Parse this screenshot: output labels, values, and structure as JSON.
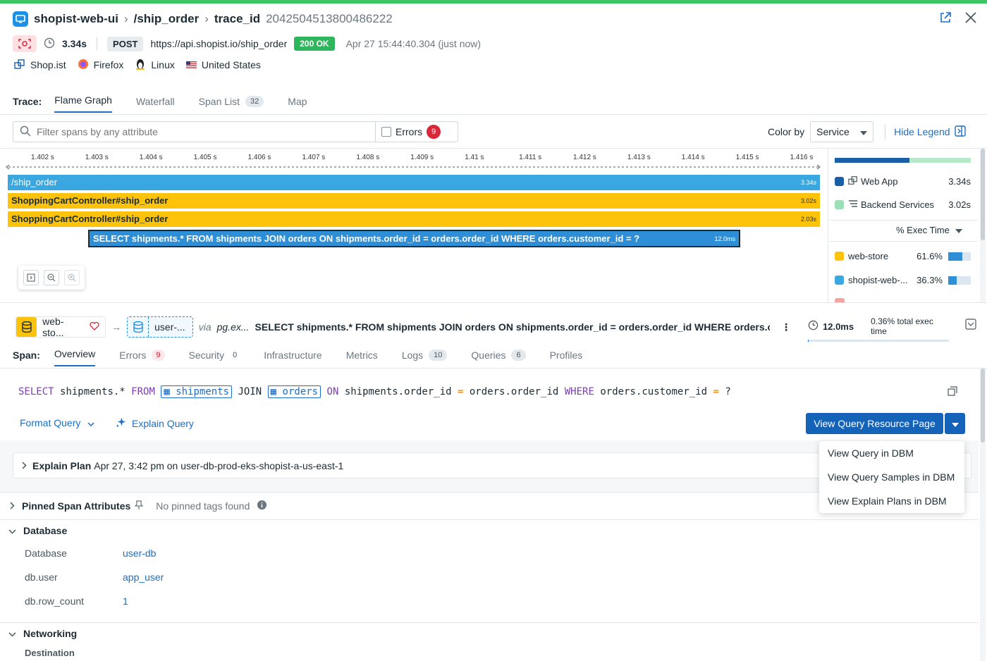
{
  "header": {
    "service": "shopist-web-ui",
    "resource": "/ship_order",
    "trace_label": "trace_id",
    "trace_id": "2042504513800486222"
  },
  "request": {
    "duration": "3.34s",
    "method": "POST",
    "url": "https://api.shopist.io/ship_order",
    "status": "200 OK",
    "timestamp": "Apr 27 15:44:40.304 (just now)"
  },
  "tags": {
    "app": "Shop.ist",
    "browser": "Firefox",
    "os": "Linux",
    "country": "United States"
  },
  "trace_tabs": {
    "label": "Trace:",
    "items": [
      {
        "label": "Flame Graph",
        "badge": ""
      },
      {
        "label": "Waterfall",
        "badge": ""
      },
      {
        "label": "Span List",
        "badge": "32"
      },
      {
        "label": "Map",
        "badge": ""
      }
    ]
  },
  "filter": {
    "placeholder": "Filter spans by any attribute",
    "errors_label": "Errors",
    "errors_count": "9",
    "color_by_label": "Color by",
    "color_by_value": "Service",
    "hide_legend": "Hide Legend"
  },
  "timeline": {
    "ticks": [
      "1.402 s",
      "1.403 s",
      "1.404 s",
      "1.405 s",
      "1.406 s",
      "1.407 s",
      "1.408 s",
      "1.409 s",
      "1.41 s",
      "1.411 s",
      "1.412 s",
      "1.413 s",
      "1.414 s",
      "1.415 s",
      "1.416 s"
    ]
  },
  "flame": {
    "bars": [
      {
        "label": "/ship_order",
        "duration": "3.34s",
        "color": "#3ba7e0"
      },
      {
        "label": "ShoppingCartController#ship_order",
        "duration": "3.02s",
        "color": "#fdc30a"
      },
      {
        "label": "ShoppingCartController#ship_order",
        "duration": "2.03s",
        "color": "#fdc30a"
      },
      {
        "label": "SELECT shipments.* FROM shipments JOIN orders ON shipments.order_id = orders.order_id WHERE orders.customer_id = ?",
        "duration": "12.0ms",
        "color": "#2e8fd6"
      }
    ]
  },
  "legend": {
    "groups": [
      {
        "name": "Web App",
        "value": "3.34s",
        "color": "#1a5ea8"
      },
      {
        "name": "Backend Services",
        "value": "3.02s",
        "color": "#9fdfb8"
      }
    ],
    "sort_label": "% Exec Time",
    "services": [
      {
        "name": "web-store",
        "pct": "61.6%",
        "color": "#fdc30a",
        "fill": 0.616
      },
      {
        "name": "shopist-web-...",
        "pct": "36.3%",
        "color": "#3ba7e0",
        "fill": 0.363
      }
    ]
  },
  "span_header": {
    "from_service": "web-sto...",
    "to_service": "user-...",
    "via": "via",
    "via_target": "pg.ex...",
    "query": "SELECT shipments.* FROM shipments JOIN orders ON shipments.order_id = orders.order_id WHERE orders.c...",
    "duration": "12.0ms",
    "exec_time": "0.36% total exec time"
  },
  "span_tabs": {
    "label": "Span:",
    "items": [
      {
        "label": "Overview",
        "badge": ""
      },
      {
        "label": "Errors",
        "badge": "9"
      },
      {
        "label": "Security",
        "badge": "0"
      },
      {
        "label": "Infrastructure",
        "badge": ""
      },
      {
        "label": "Metrics",
        "badge": ""
      },
      {
        "label": "Logs",
        "badge": "10"
      },
      {
        "label": "Queries",
        "badge": "6"
      },
      {
        "label": "Profiles",
        "badge": ""
      }
    ]
  },
  "sql": {
    "select": "SELECT",
    "cols": "shipments.*",
    "from": "FROM",
    "table1": "shipments",
    "join": "JOIN",
    "table2": "orders",
    "on": "ON",
    "cond1": "shipments.order_id",
    "eq": "=",
    "cond2": "orders.order_id",
    "where": "WHERE",
    "cond3": "orders.customer_id",
    "eq2": "=",
    "param": "?"
  },
  "actions": {
    "format_query": "Format Query",
    "explain_query": "Explain Query",
    "view_resource": "View Query Resource Page",
    "menu": [
      "View Query in DBM",
      "View Query Samples in DBM",
      "View Explain Plans in DBM"
    ]
  },
  "explain_plan": {
    "label": "Explain Plan",
    "detail": "Apr 27, 3:42 pm on user-db-prod-eks-shopist-a-us-east-1"
  },
  "pinned": {
    "label": "Pinned Span Attributes",
    "empty": "No pinned tags found"
  },
  "database": {
    "title": "Database",
    "rows": [
      {
        "key": "Database",
        "value": "user-db"
      },
      {
        "key": "db.user",
        "value": "app_user"
      },
      {
        "key": "db.row_count",
        "value": "1"
      }
    ]
  },
  "networking": {
    "title": "Networking",
    "sub": "Destination"
  }
}
